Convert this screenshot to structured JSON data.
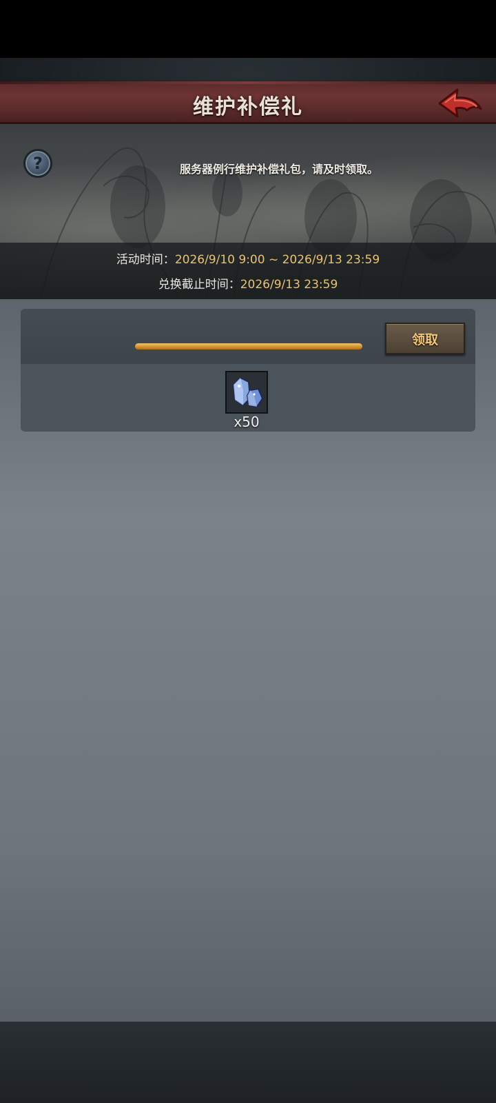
{
  "header": {
    "title": "维护补偿礼"
  },
  "info": {
    "description": "服务器例行维护补偿礼包，请及时领取。",
    "activity_time_label": "活动时间：",
    "activity_time_value": "2026/9/10 9:00 ~ 2026/9/13 23:59",
    "redeem_deadline_label": "兑换截止时间：",
    "redeem_deadline_value": "2026/9/13 23:59"
  },
  "reward": {
    "progress_fraction": 1.0,
    "claim_label": "领取",
    "item_icon": "crystal-icon",
    "item_count": "x50"
  },
  "colors": {
    "accent_gold": "#e8c27a",
    "title_banner": "#6e3434",
    "back_arrow": "#c0302a"
  }
}
